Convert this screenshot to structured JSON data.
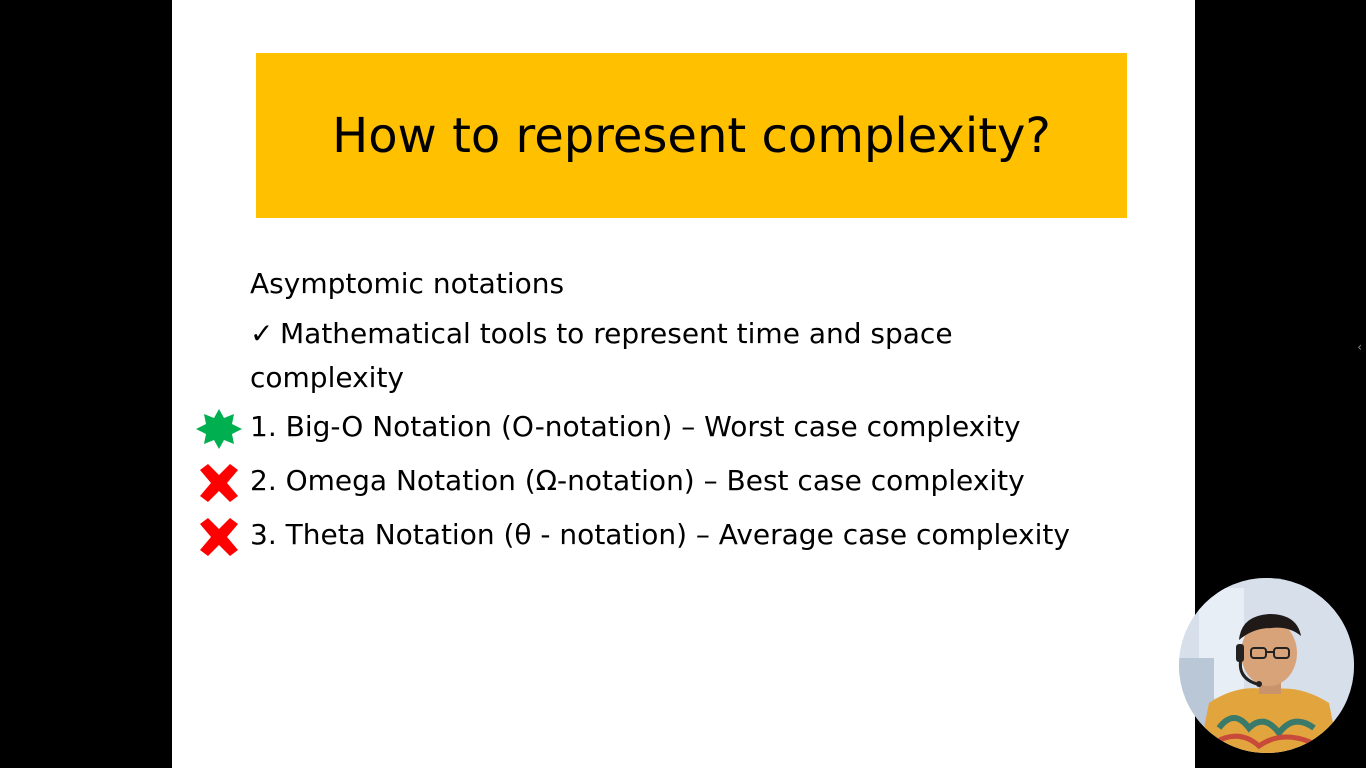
{
  "slide": {
    "title": "How to represent complexity?",
    "heading": "Asymptomic notations",
    "check_symbol": "✓",
    "check_text": "Mathematical tools to represent time and space complexity",
    "items": [
      {
        "text": "1. Big-O Notation (O-notation) – Worst case complexity",
        "marker": "green-star-icon"
      },
      {
        "text": "2. Omega Notation (Ω-notation) – Best case complexity",
        "marker": "red-x-icon"
      },
      {
        "text": "3. Theta Notation (θ - notation) – Average case complexity",
        "marker": "red-x-icon"
      }
    ],
    "colors": {
      "title_bg": "#FFC000",
      "star": "#00B050",
      "cross": "#FF0000"
    }
  },
  "viewer": {
    "collapse_glyph": "‹"
  }
}
